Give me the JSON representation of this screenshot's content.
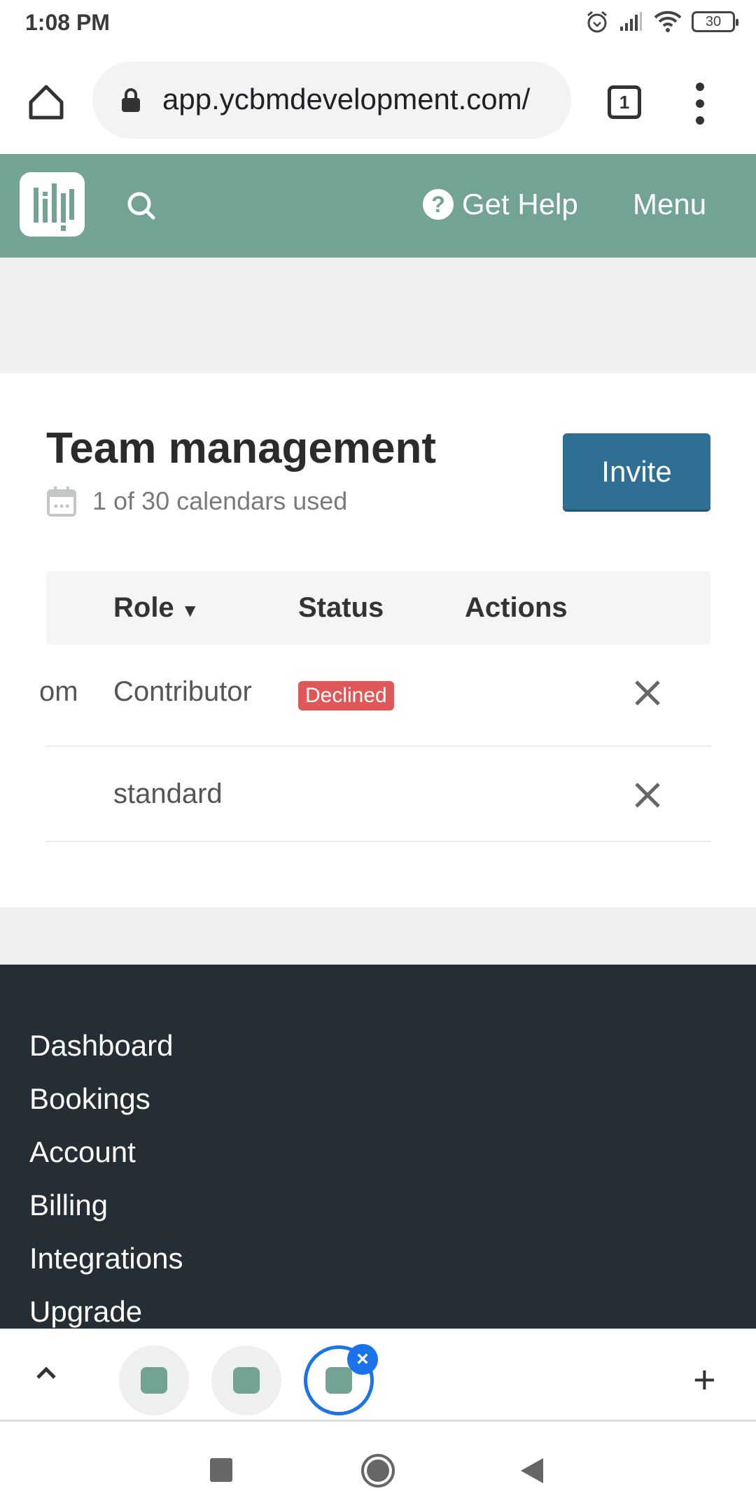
{
  "status_bar": {
    "time": "1:08 PM",
    "battery": "30",
    "icons": [
      "alarm-icon",
      "signal-icon",
      "wifi-icon",
      "battery-icon"
    ]
  },
  "browser": {
    "url": "app.ycbmdevelopment.com/",
    "tab_count": "1"
  },
  "app_header": {
    "help_label": "Get Help",
    "menu_label": "Menu",
    "accent_color": "#72a394"
  },
  "page": {
    "title": "Team management",
    "calendars_used": "1 of 30 calendars used",
    "invite_label": "Invite",
    "invite_color": "#2f6f94"
  },
  "table": {
    "columns": [
      "Role",
      "Status",
      "Actions"
    ],
    "sort_indicator": "▼",
    "rows": [
      {
        "email_fragment": "om",
        "role": "Contributor",
        "status": "Declined",
        "status_color": "#e05757"
      },
      {
        "email_fragment": "",
        "role": "standard",
        "status": ""
      }
    ]
  },
  "footer": {
    "links": [
      "Dashboard",
      "Bookings",
      "Account",
      "Billing",
      "Integrations",
      "Upgrade"
    ]
  },
  "tab_strip": {
    "close_label": "×",
    "new_tab_label": "+"
  }
}
